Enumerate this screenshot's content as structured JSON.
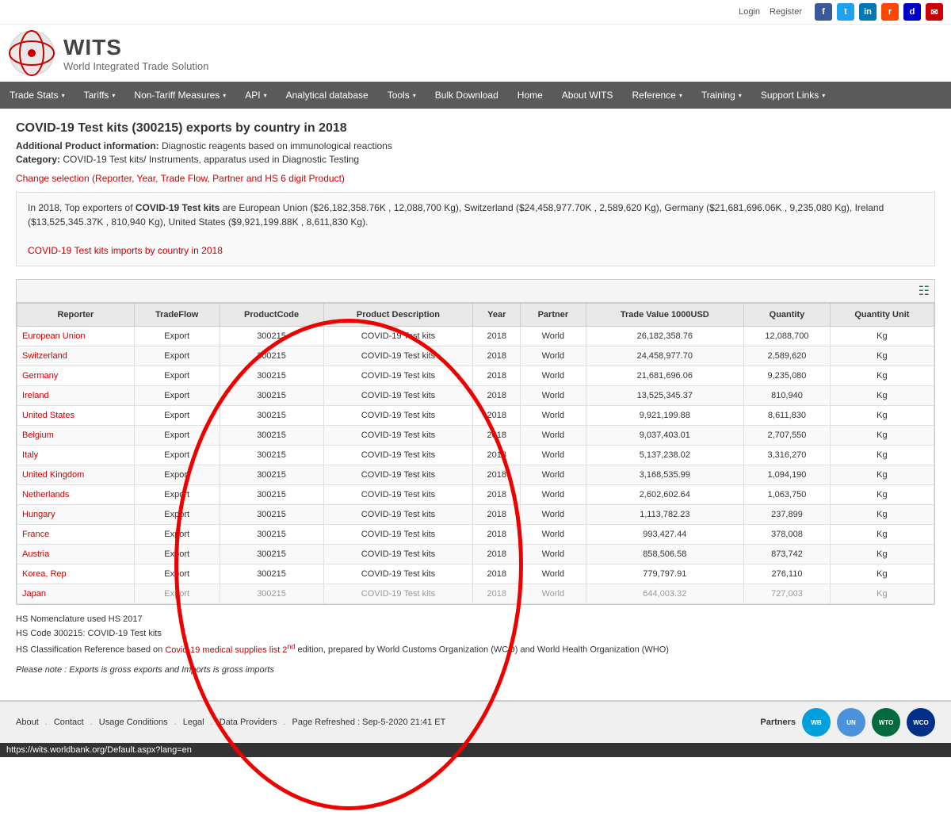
{
  "topBar": {
    "login": "Login",
    "register": "Register"
  },
  "logo": {
    "wits": "WITS",
    "subtitle": "World Integrated Trade Solution"
  },
  "nav": {
    "items": [
      {
        "label": "Trade Stats",
        "hasDropdown": true
      },
      {
        "label": "Tariffs",
        "hasDropdown": true
      },
      {
        "label": "Non-Tariff Measures",
        "hasDropdown": true
      },
      {
        "label": "API",
        "hasDropdown": true
      },
      {
        "label": "Analytical database",
        "hasDropdown": false
      },
      {
        "label": "Tools",
        "hasDropdown": true
      },
      {
        "label": "Bulk Download",
        "hasDropdown": false
      },
      {
        "label": "Home",
        "hasDropdown": false
      },
      {
        "label": "About WITS",
        "hasDropdown": false
      },
      {
        "label": "Reference",
        "hasDropdown": true
      },
      {
        "label": "Training",
        "hasDropdown": true
      },
      {
        "label": "Support Links",
        "hasDropdown": true
      }
    ]
  },
  "page": {
    "title": "COVID-19 Test kits (300215) exports by country in 2018",
    "productInfoLabel": "Additional Product information:",
    "productInfoValue": "Diagnostic reagents based on immunological reactions",
    "categoryLabel": "Category:",
    "categoryValue": "COVID-19 Test kits/ Instruments, apparatus used in Diagnostic Testing",
    "changeSelection": "Change selection (Reporter, Year, Trade Flow, Partner and HS 6 digit Product)"
  },
  "summary": {
    "text1": "In 2018, Top exporters of ",
    "highlight": "COVID-19 Test kits",
    "text2": " are European Union ($26,182,358.76K , 12,088,700 Kg), Switzerland ($24,458,977.70K , 2,589,620 Kg), Germany ($21,681,696.06K , 9,235,080 Kg), Ireland ($13,525,345.37K , 810,940 Kg), United States ($9,921,199.88K , 8,611,830 Kg).",
    "importsLink": "COVID-19 Test kits imports by country in 2018"
  },
  "table": {
    "headers": [
      "Reporter",
      "TradeFlow",
      "ProductCode",
      "Product Description",
      "Year",
      "Partner",
      "Trade Value 1000USD",
      "Quantity",
      "Quantity Unit"
    ],
    "rows": [
      {
        "reporter": "European Union",
        "tradeflow": "Export",
        "code": "300215",
        "description": "COVID-19 Test kits",
        "year": "2018",
        "partner": "World",
        "value": "26,182,358.76",
        "quantity": "12,088,700",
        "unit": "Kg"
      },
      {
        "reporter": "Switzerland",
        "tradeflow": "Export",
        "code": "300215",
        "description": "COVID-19 Test kits",
        "year": "2018",
        "partner": "World",
        "value": "24,458,977.70",
        "quantity": "2,589,620",
        "unit": "Kg"
      },
      {
        "reporter": "Germany",
        "tradeflow": "Export",
        "code": "300215",
        "description": "COVID-19 Test kits",
        "year": "2018",
        "partner": "World",
        "value": "21,681,696.06",
        "quantity": "9,235,080",
        "unit": "Kg"
      },
      {
        "reporter": "Ireland",
        "tradeflow": "Export",
        "code": "300215",
        "description": "COVID-19 Test kits",
        "year": "2018",
        "partner": "World",
        "value": "13,525,345.37",
        "quantity": "810,940",
        "unit": "Kg"
      },
      {
        "reporter": "United States",
        "tradeflow": "Export",
        "code": "300215",
        "description": "COVID-19 Test kits",
        "year": "2018",
        "partner": "World",
        "value": "9,921,199.88",
        "quantity": "8,611,830",
        "unit": "Kg"
      },
      {
        "reporter": "Belgium",
        "tradeflow": "Export",
        "code": "300215",
        "description": "COVID-19 Test kits",
        "year": "2018",
        "partner": "World",
        "value": "9,037,403.01",
        "quantity": "2,707,550",
        "unit": "Kg"
      },
      {
        "reporter": "Italy",
        "tradeflow": "Export",
        "code": "300215",
        "description": "COVID-19 Test kits",
        "year": "2018",
        "partner": "World",
        "value": "5,137,238.02",
        "quantity": "3,316,270",
        "unit": "Kg"
      },
      {
        "reporter": "United Kingdom",
        "tradeflow": "Export",
        "code": "300215",
        "description": "COVID-19 Test kits",
        "year": "2018",
        "partner": "World",
        "value": "3,168,535.99",
        "quantity": "1,094,190",
        "unit": "Kg"
      },
      {
        "reporter": "Netherlands",
        "tradeflow": "Export",
        "code": "300215",
        "description": "COVID-19 Test kits",
        "year": "2018",
        "partner": "World",
        "value": "2,602,602.64",
        "quantity": "1,063,750",
        "unit": "Kg"
      },
      {
        "reporter": "Hungary",
        "tradeflow": "Export",
        "code": "300215",
        "description": "COVID-19 Test kits",
        "year": "2018",
        "partner": "World",
        "value": "1,113,782.23",
        "quantity": "237,899",
        "unit": "Kg"
      },
      {
        "reporter": "France",
        "tradeflow": "Export",
        "code": "300215",
        "description": "COVID-19 Test kits",
        "year": "2018",
        "partner": "World",
        "value": "993,427.44",
        "quantity": "378,008",
        "unit": "Kg"
      },
      {
        "reporter": "Austria",
        "tradeflow": "Export",
        "code": "300215",
        "description": "COVID-19 Test kits",
        "year": "2018",
        "partner": "World",
        "value": "858,506.58",
        "quantity": "873,742",
        "unit": "Kg"
      },
      {
        "reporter": "Korea, Rep",
        "tradeflow": "Export",
        "code": "300215",
        "description": "COVID-19 Test kits",
        "year": "2018",
        "partner": "World",
        "value": "779,797.91",
        "quantity": "276,110",
        "unit": "Kg"
      },
      {
        "reporter": "Japan",
        "tradeflow": "Export",
        "code": "300215",
        "description": "COVID-19 Test kits",
        "year": "2018",
        "partner": "World",
        "value": "644,003.32",
        "quantity": "727,003",
        "unit": "Kg"
      }
    ],
    "lastRowPartial": true
  },
  "footnotes": {
    "line1": "HS Nomenclature used HS 2017",
    "line2": "HS Code 300215: COVID-19 Test kits",
    "line3prefix": "HS Classification Reference based on ",
    "line3link": "Covid-19 medical supplies list 2",
    "line3sup": "nd",
    "line3suffix": " edition, prepared by World Customs Organization (WCO) and World Health Organization (WHO)"
  },
  "pleaseNote": "Please note : Exports is gross exports and Imports is gross imports",
  "footer": {
    "links": [
      "About",
      "Contact",
      "Usage Conditions",
      "Legal",
      "Data Providers"
    ],
    "refreshLabel": "Page Refreshed : Sep-5-2020 21:41 ET",
    "partnersLabel": "Partners"
  },
  "urlBar": "https://wits.worldbank.org/Default.aspx?lang=en"
}
